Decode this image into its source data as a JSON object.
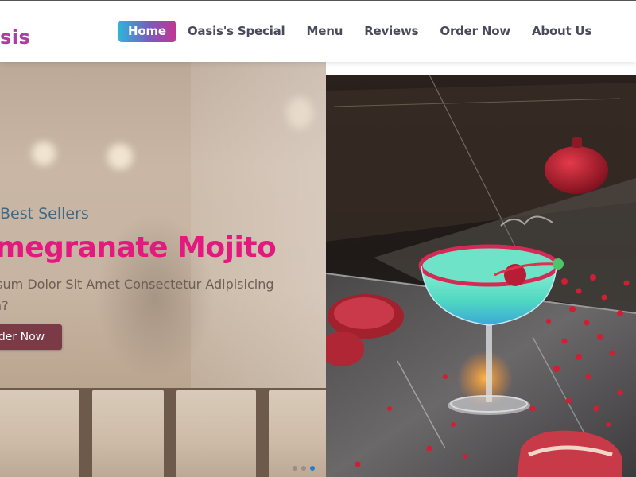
{
  "brand": {
    "name": "sis"
  },
  "nav": {
    "items": [
      {
        "label": "Home",
        "active": true
      },
      {
        "label": "Oasis's Special",
        "active": false
      },
      {
        "label": "Menu",
        "active": false
      },
      {
        "label": "Reviews",
        "active": false
      },
      {
        "label": "Order Now",
        "active": false
      },
      {
        "label": "About Us",
        "active": false
      }
    ]
  },
  "hero": {
    "subtitle": "Best Sellers",
    "title": "omegranate Mojito",
    "description": "n, Ipsum Dolor Sit Amet Consectetur Adipisicing\n, Non?",
    "button_label": "der Now"
  },
  "carousel": {
    "slide_count": 3,
    "active_index": 2
  },
  "colors": {
    "accent": "#e4197f",
    "brand": "#b33aa0",
    "button": "#7a3a46",
    "nav_active_gradient": [
      "#2fb3d9",
      "#7a5bbf",
      "#c2368f"
    ]
  }
}
